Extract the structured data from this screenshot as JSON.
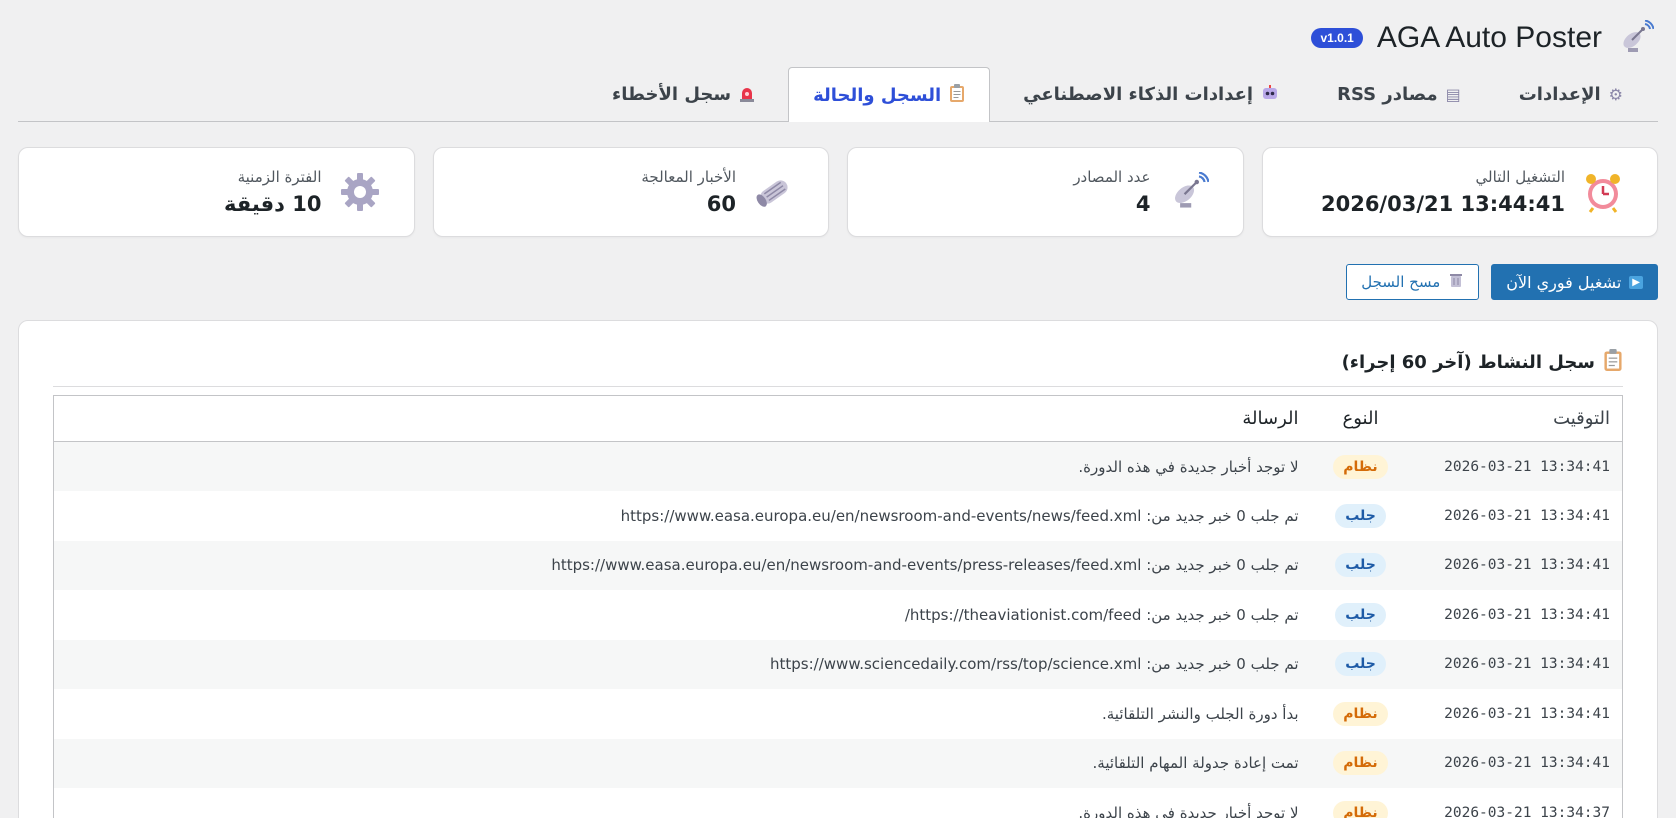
{
  "header": {
    "title": "AGA Auto Poster",
    "version": "v1.0.1",
    "icon": "satellite-dish-icon"
  },
  "tabs": [
    {
      "label": "الإعدادات",
      "icon": "gear-icon",
      "active": false
    },
    {
      "label": "مصادر RSS",
      "icon": "newspaper-icon",
      "active": false
    },
    {
      "label": "إعدادات الذكاء الاصطناعي",
      "icon": "robot-icon",
      "active": false
    },
    {
      "label": "السجل والحالة",
      "icon": "clipboard-icon",
      "active": true
    },
    {
      "label": "سجل الأخطاء",
      "icon": "siren-icon",
      "active": false
    }
  ],
  "stats": [
    {
      "label": "التشغيل التالي",
      "value": "2026/03/21 13:44:41",
      "icon": "alarm-clock-icon"
    },
    {
      "label": "عدد المصادر",
      "value": "4",
      "icon": "satellite-dish-icon"
    },
    {
      "label": "الأخبار المعالجة",
      "value": "60",
      "icon": "rolled-newspaper-icon"
    },
    {
      "label": "الفترة الزمنية",
      "value": "10 دقيقة",
      "icon": "gear-icon"
    }
  ],
  "actions": {
    "run_now": "تشغيل فوري الآن",
    "clear_log": "مسح السجل"
  },
  "log": {
    "title": "سجل النشاط (آخر 60 إجراء)",
    "columns": {
      "time": "التوقيت",
      "type": "النوع",
      "message": "الرسالة"
    },
    "rows": [
      {
        "time": "2026-03-21 13:34:41",
        "type": "نظام",
        "kind": "system",
        "message": "لا توجد أخبار جديدة في هذه الدورة."
      },
      {
        "time": "2026-03-21 13:34:41",
        "type": "جلب",
        "kind": "fetch",
        "message": "تم جلب 0 خبر جديد من: https://www.easa.europa.eu/en/newsroom-and-events/news/feed.xml"
      },
      {
        "time": "2026-03-21 13:34:41",
        "type": "جلب",
        "kind": "fetch",
        "message": "تم جلب 0 خبر جديد من: https://www.easa.europa.eu/en/newsroom-and-events/press-releases/feed.xml"
      },
      {
        "time": "2026-03-21 13:34:41",
        "type": "جلب",
        "kind": "fetch",
        "message": "تم جلب 0 خبر جديد من: https://theaviationist.com/feed/"
      },
      {
        "time": "2026-03-21 13:34:41",
        "type": "جلب",
        "kind": "fetch",
        "message": "تم جلب 0 خبر جديد من: https://www.sciencedaily.com/rss/top/science.xml"
      },
      {
        "time": "2026-03-21 13:34:41",
        "type": "نظام",
        "kind": "system",
        "message": "بدأ دورة الجلب والنشر التلقائية."
      },
      {
        "time": "2026-03-21 13:34:41",
        "type": "نظام",
        "kind": "system",
        "message": "تمت إعادة جدولة المهام التلقائية."
      },
      {
        "time": "2026-03-21 13:34:37",
        "type": "نظام",
        "kind": "system",
        "message": "لا توجد أخبار جديدة في هذه الدورة."
      }
    ]
  }
}
